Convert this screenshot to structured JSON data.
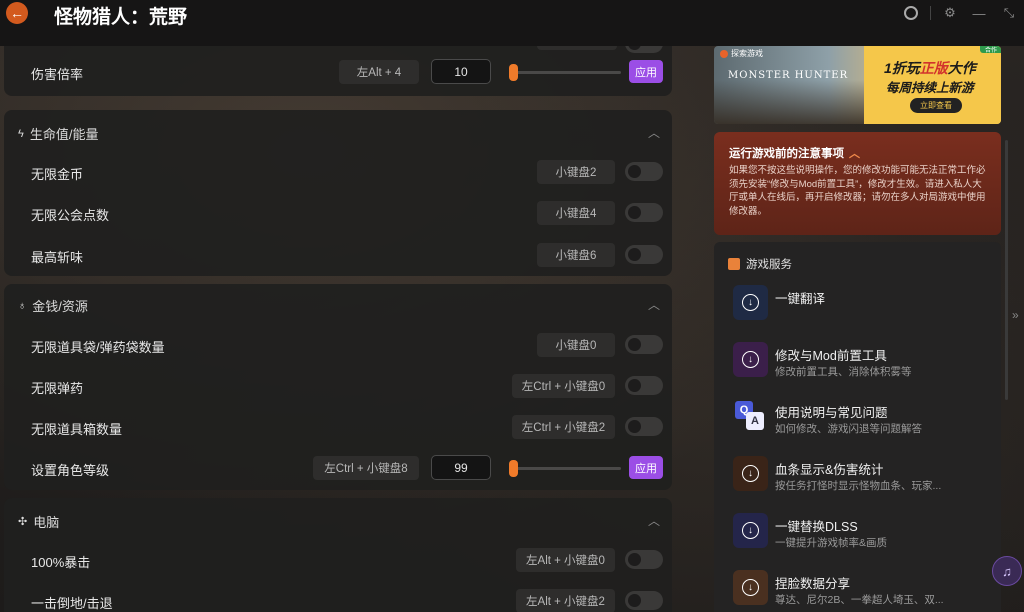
{
  "titlebar": {
    "back_icon": "arrow-left-icon",
    "title": "怪物猎人：荒野",
    "accent": "#d35a1e"
  },
  "sections": [
    {
      "title": "",
      "rows": [
        {
          "label": "伤害倍率",
          "hotkey": "左Alt + 4",
          "type": "slider",
          "value": "10",
          "level": 0.0,
          "apply": "应用"
        }
      ]
    },
    {
      "title": "生命值/能量",
      "icon": "lightning-icon",
      "rows": [
        {
          "label": "无限金币",
          "hotkey": "小键盘2",
          "type": "toggle",
          "on": false
        },
        {
          "label": "无限公会点数",
          "hotkey": "小键盘4",
          "type": "toggle",
          "on": false
        },
        {
          "label": "最高斩味",
          "hotkey": "小键盘6",
          "type": "toggle",
          "on": false
        }
      ]
    },
    {
      "title": "金钱/资源",
      "icon": "money-bag-icon",
      "rows": [
        {
          "label": "无限道具袋/弹药袋数量",
          "hotkey": "小键盘0",
          "type": "toggle",
          "on": false
        },
        {
          "label": "无限弹药",
          "hotkey": "左Ctrl + 小键盘0",
          "type": "toggle",
          "on": false
        },
        {
          "label": "无限道具箱数量",
          "hotkey": "左Ctrl + 小键盘2",
          "type": "toggle",
          "on": false
        },
        {
          "label": "设置角色等级",
          "hotkey": "左Ctrl + 小键盘8",
          "type": "slider",
          "value": "99",
          "level": 0.0,
          "apply": "应用"
        }
      ]
    },
    {
      "title": "电脑",
      "icon": "sparkle-icon",
      "rows": [
        {
          "label": "100%暴击",
          "hotkey": "左Alt + 小键盘0",
          "type": "toggle",
          "on": false
        },
        {
          "label": "一击倒地/击退",
          "hotkey": "左Alt + 小键盘2",
          "type": "toggle",
          "on": false
        }
      ]
    }
  ],
  "ad": {
    "badge": "探索游戏",
    "logo": "MONSTER HUNTER",
    "title_prefix": "1折玩",
    "title_highlight": "正版",
    "title_suffix": "大作",
    "subtitle": "每周持续上新游",
    "button": "立即查看",
    "tag": "合作"
  },
  "notice": {
    "title": "运行游戏前的注意事项",
    "body": "如果您不按这些说明操作，您的修改功能可能无法正常工作必须先安装“修改与Mod前置工具”，修改才生效。请进入私人大厅或单人在线后，再开启修改器；请勿在多人对局游戏中使用修改器。"
  },
  "services": {
    "title": "游戏服务",
    "items": [
      {
        "name": "一键翻译",
        "desc": "",
        "icon": "download-circle-icon",
        "bg": "#1f2a44"
      },
      {
        "name": "修改与Mod前置工具",
        "desc": "修改前置工具、消除体积雾等",
        "icon": "download-circle-icon",
        "bg": "#3b1f4a"
      },
      {
        "name": "使用说明与常见问题",
        "desc": "如何修改、游戏闪退等问题解答",
        "icon": "qa-icon",
        "bg": "#2a2a60"
      },
      {
        "name": "血条显示&伤害统计",
        "desc": "按任务打怪时显示怪物血条、玩家...",
        "icon": "download-circle-icon",
        "bg": "#3a2418"
      },
      {
        "name": "一键替换DLSS",
        "desc": "一键提升游戏帧率&画质",
        "icon": "download-circle-icon",
        "bg": "#24254a"
      },
      {
        "name": "捏脸数据分享",
        "desc": "尊达、尼尔2B、一拳超人埼玉、双...",
        "icon": "download-circle-icon",
        "bg": "#4a3020"
      }
    ]
  },
  "colors": {
    "apply": "#9b4ee6",
    "slider_thumb": "#f07b2a",
    "notice_bg": "#7a2e1e"
  }
}
